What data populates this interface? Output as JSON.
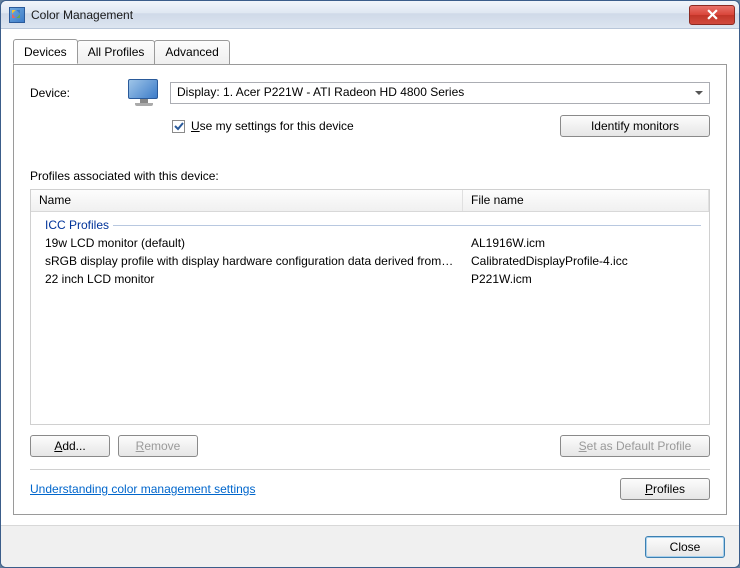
{
  "window": {
    "title": "Color Management"
  },
  "tabs": {
    "devices": "Devices",
    "all_profiles": "All Profiles",
    "advanced": "Advanced"
  },
  "device": {
    "label": "Device:",
    "selected": "Display: 1. Acer P221W - ATI Radeon HD 4800 Series",
    "use_settings_label": "se my settings for this device",
    "use_settings_prefix": "U",
    "use_settings_checked": true,
    "identify_button": "Identify monitors"
  },
  "profiles_section": {
    "label": "Profiles associated with this device:",
    "columns": {
      "name": "Name",
      "file": "File name"
    },
    "group_header": "ICC Profiles",
    "rows": [
      {
        "name": "19w LCD monitor (default)",
        "file": "AL1916W.icm"
      },
      {
        "name": "sRGB display profile with display hardware configuration data derived from cali...",
        "file": "CalibratedDisplayProfile-4.icc"
      },
      {
        "name": "22 inch LCD monitor",
        "file": "P221W.icm"
      }
    ]
  },
  "buttons": {
    "add": "dd...",
    "add_prefix": "A",
    "remove": "emove",
    "remove_prefix": "R",
    "set_default": "et as Default Profile",
    "set_default_prefix": "S",
    "profiles": "rofiles",
    "profiles_prefix": "P",
    "close": "Close"
  },
  "link": {
    "understanding": "Understanding color management settings"
  }
}
